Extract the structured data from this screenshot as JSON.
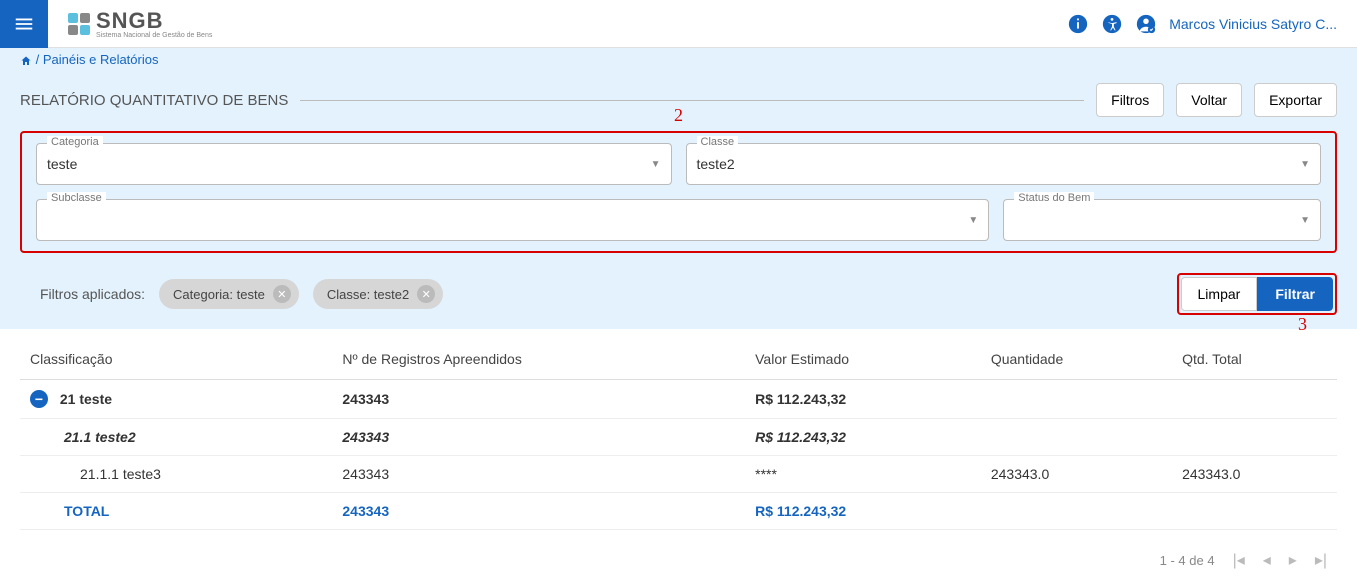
{
  "header": {
    "logo_text": "SNGB",
    "logo_sub": "Sistema Nacional de Gestão de Bens",
    "user_name": "Marcos Vinicius Satyro C..."
  },
  "breadcrumb": {
    "link": "Painéis e Relatórios",
    "sep": " / "
  },
  "page": {
    "title": "RELATÓRIO QUANTITATIVO DE BENS",
    "buttons": {
      "filtros": "Filtros",
      "voltar": "Voltar",
      "exportar": "Exportar"
    }
  },
  "filters": {
    "categoria": {
      "label": "Categoria",
      "value": "teste"
    },
    "classe": {
      "label": "Classe",
      "value": "teste2"
    },
    "subclasse": {
      "label": "Subclasse",
      "value": ""
    },
    "status": {
      "label": "Status do Bem",
      "value": ""
    }
  },
  "applied": {
    "label": "Filtros aplicados:",
    "chips": [
      "Categoria: teste",
      "Classe: teste2"
    ],
    "clear": "Limpar",
    "filter": "Filtrar"
  },
  "annotations": {
    "n2": "2",
    "n3": "3"
  },
  "table": {
    "headers": {
      "classificacao": "Classificação",
      "registros": "Nº de Registros Apreendidos",
      "valor": "Valor Estimado",
      "quantidade": "Quantidade",
      "qtdtotal": "Qtd. Total"
    },
    "rows": [
      {
        "level": 0,
        "c1": "21 teste",
        "c2": "243343",
        "c3": "R$ 112.243,32",
        "c4": "",
        "c5": ""
      },
      {
        "level": 1,
        "c1": "21.1 teste2",
        "c2": "243343",
        "c3": "R$ 112.243,32",
        "c4": "",
        "c5": ""
      },
      {
        "level": 2,
        "c1": "21.1.1 teste3",
        "c2": "243343",
        "c3": "****",
        "c4": "243343.0",
        "c5": "243343.0"
      }
    ],
    "total": {
      "label": "TOTAL",
      "c2": "243343",
      "c3": "R$ 112.243,32",
      "c4": "",
      "c5": ""
    }
  },
  "pagination": {
    "range": "1 - 4 de 4"
  }
}
